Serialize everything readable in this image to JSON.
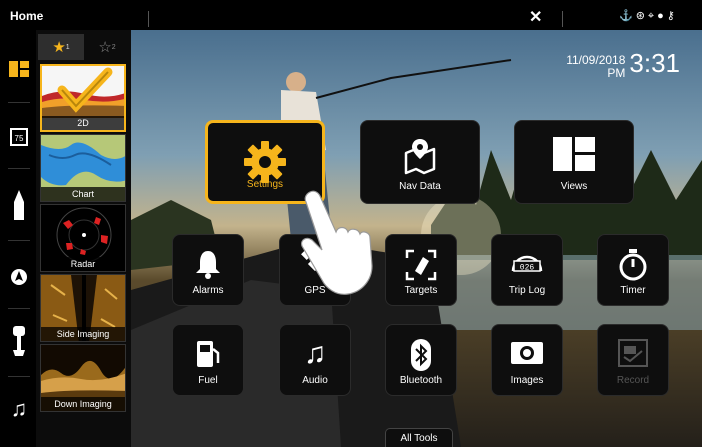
{
  "topbar": {
    "title": "Home"
  },
  "favorites": {
    "tab_active_label": "★",
    "tab_active_sub": "1",
    "tab_inactive_label": "☆",
    "tab_inactive_sub": "2",
    "items": [
      {
        "label": "2D"
      },
      {
        "label": "Chart"
      },
      {
        "label": "Radar"
      },
      {
        "label": "Side Imaging"
      },
      {
        "label": "Down Imaging"
      }
    ]
  },
  "clock": {
    "date": "11/09/2018",
    "ampm": "PM",
    "time": "3:31"
  },
  "tiles": {
    "settings": "Settings",
    "nav_data": "Nav Data",
    "views": "Views",
    "alarms": "Alarms",
    "gps": "GPS",
    "targets": "Targets",
    "trip_log": "Trip Log",
    "timer": "Timer",
    "fuel": "Fuel",
    "audio": "Audio",
    "bluetooth": "Bluetooth",
    "images": "Images",
    "record": "Record"
  },
  "all_tools": "All Tools",
  "colors": {
    "accent": "#f6b51c",
    "tile_bg": "#0e0e0e",
    "disabled_text": "#555555"
  },
  "icons": {
    "rail": [
      "views-icon",
      "gauge-icon",
      "boat-icon",
      "compass-icon",
      "motor-icon",
      "music-icon"
    ],
    "status": [
      "anchor-icon",
      "wheel-icon",
      "gps-icon",
      "nav-icon",
      "key-icon"
    ]
  }
}
